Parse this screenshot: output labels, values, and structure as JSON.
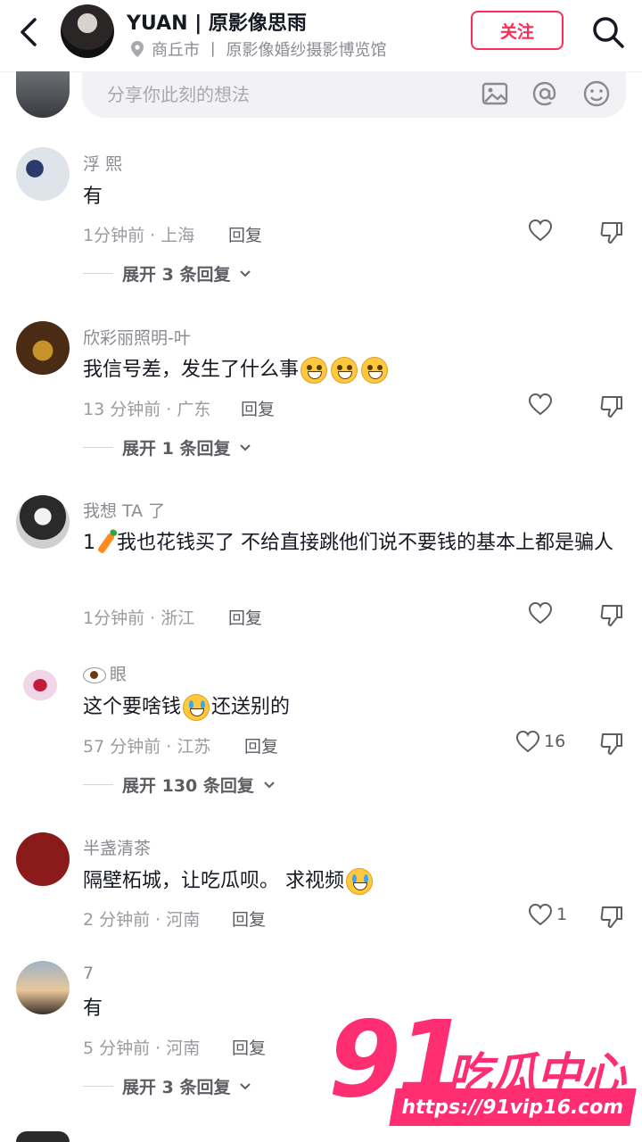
{
  "header": {
    "name": "YUAN | 原影像思雨",
    "location": "商丘市 丨 原影像婚纱摄影博览馆",
    "follow_label": "关注"
  },
  "composer": {
    "placeholder": "分享你此刻的想法"
  },
  "comments": [
    {
      "user": "浮 熙",
      "text": "有",
      "time": "1分钟前 · 上海",
      "reply": "回复",
      "likes": "",
      "expand": "展开 3 条回复"
    },
    {
      "user": "欣彩丽照明-叶",
      "text": "我信号差，发生了什么事",
      "time": "13 分钟前 · 广东",
      "reply": "回复",
      "likes": "",
      "expand": "展开 1 条回复"
    },
    {
      "user": "我想 TA 了",
      "text_a": "1",
      "text_b": "我也花钱买了  不给直接跳他们说不要钱的基本上都是骗人",
      "time": "1分钟前 · 浙江",
      "reply": "回复",
      "likes": ""
    },
    {
      "user": "眼",
      "text_a": "这个要啥钱",
      "text_b": "还送别的",
      "time": "57 分钟前 · 江苏",
      "reply": "回复",
      "likes": "16",
      "expand": "展开 130 条回复"
    },
    {
      "user": "半盏清茶",
      "text": "隔壁柘城，让吃瓜呗。 求视频",
      "time": "2 分钟前 · 河南",
      "reply": "回复",
      "likes": "1"
    },
    {
      "user": "7",
      "text": "有",
      "time": "5 分钟前 · 河南",
      "reply": "回复",
      "likes": "",
      "expand": "展开 3 条回复"
    }
  ],
  "watermark": {
    "logo_number": "91",
    "logo_text": "吃瓜中心",
    "url": "https://91vip16.com"
  },
  "colors": {
    "accent": "#fe2c55",
    "watermark": "#ff2e72"
  }
}
